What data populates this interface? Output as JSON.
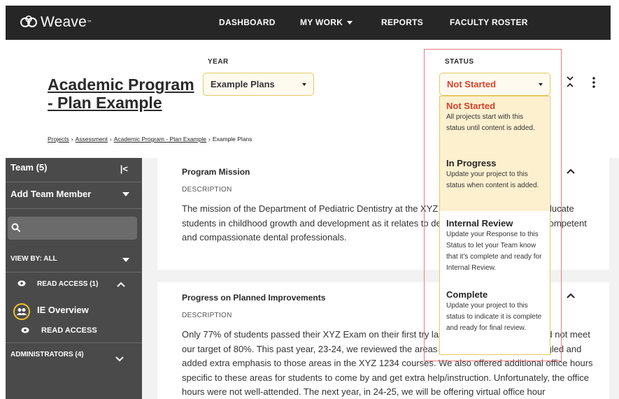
{
  "brand": {
    "name": "Weave",
    "tm": "™"
  },
  "nav": {
    "dashboard": "DASHBOARD",
    "my_work": "MY WORK",
    "reports": "REPORTS",
    "faculty_roster": "FACULTY ROSTER"
  },
  "header": {
    "title": "Academic Program - Plan Example",
    "breadcrumb": [
      "Projects",
      "Assessment",
      "Academic Program - Plan Example",
      "Example Plans"
    ],
    "breadcrumb_sep": "›"
  },
  "year": {
    "label": "YEAR",
    "value": "Example Plans"
  },
  "status": {
    "label": "STATUS",
    "value": "Not Started",
    "options": [
      {
        "title": "Not Started",
        "desc": "All projects start with this status until content is added."
      },
      {
        "title": "In Progress",
        "desc": "Update your project to this status when content is added."
      },
      {
        "title": "Internal Review",
        "desc": "Update your Response to this Status to let your Team know that it's complete and ready for Internal Review."
      },
      {
        "title": "Complete",
        "desc": "Update your project to this status to indicate it is complete and ready for final review."
      }
    ]
  },
  "sidebar": {
    "team": "Team (5)",
    "collapse": "|<",
    "add_team_member": "Add Team Member",
    "view_by": "VIEW BY: ALL",
    "read_access_group": "READ ACCESS (1)",
    "member_name": "IE Overview",
    "member_access": "READ ACCESS",
    "administrators": "ADMINISTRATORS (4)"
  },
  "cards": [
    {
      "title": "Program Mission",
      "label": "DESCRIPTION",
      "text": "The mission of the Department of Pediatric Dentistry at the XYZ College of Dentistry is to educate students in childhood growth and development as it relates to dental care, and to produce competent and compassionate dental professionals."
    },
    {
      "title": "Progress on Planned Improvements",
      "label": "DESCRIPTION",
      "text": "Only 77% of students passed their XYZ Exam on their first try last year, which means we did not meet our target of 80%. This past year, 23-24, we reviewed the areas where students most struggled and added extra emphasis to those areas in the XYZ 1234 courses. We also offered additional office hours specific to these areas for students to come by and get extra help/instruction. Unfortunately, the office hours were not well-attended. The next year, in 24-25, we will be offering virtual office hour"
    }
  ],
  "colors": {
    "nav_bg": "#262626",
    "sidebar_bg": "#4a4a4a",
    "accent_yellow": "#e6c95f",
    "status_red": "#d6422c",
    "highlight_red": "#e8797f"
  }
}
